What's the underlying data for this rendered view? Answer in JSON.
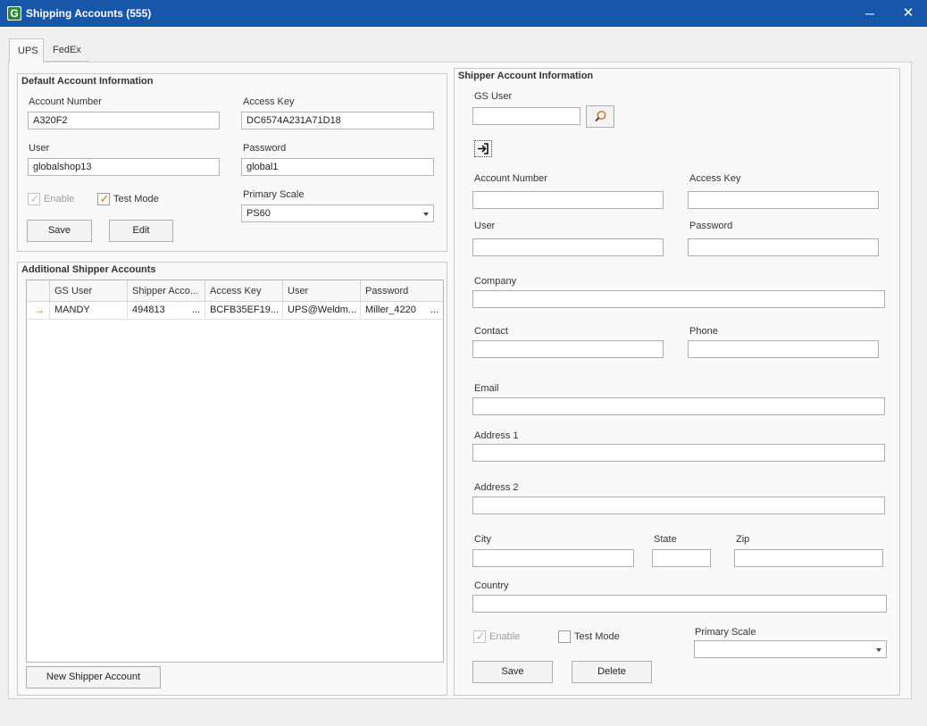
{
  "window": {
    "title": "Shipping Accounts (555)",
    "logo_letter": "G",
    "minimize_glyph": "─",
    "close_glyph": "✕"
  },
  "tabs": [
    {
      "label": "UPS",
      "selected": true
    },
    {
      "label": "FedEx",
      "selected": false
    }
  ],
  "default_account": {
    "title": "Default Account Information",
    "account_number_label": "Account Number",
    "account_number": "A320F2",
    "access_key_label": "Access Key",
    "access_key": "DC6574A231A71D18",
    "user_label": "User",
    "user": "globalshop13",
    "password_label": "Password",
    "password": "global1",
    "enable_label": "Enable",
    "enable_checked": true,
    "test_mode_label": "Test Mode",
    "test_mode_checked": true,
    "primary_scale_label": "Primary Scale",
    "primary_scale": "PS60",
    "save_label": "Save",
    "edit_label": "Edit"
  },
  "additional_accounts": {
    "title": "Additional Shipper Accounts",
    "columns": [
      "GS User",
      "Shipper Acco...",
      "Access Key",
      "User",
      "Password"
    ],
    "rows": [
      {
        "gs_user": "MANDY",
        "shipper_account": "494813",
        "shipper_more": "...",
        "access_key": "BCFB35EF19...",
        "user": "UPS@Weldm...",
        "password": "Miller_4220",
        "password_more": "..."
      }
    ],
    "current_row_glyph": "→",
    "new_button_label": "New Shipper Account"
  },
  "shipper_account": {
    "title": "Shipper Account Information",
    "gs_user_label": "GS User",
    "gs_user": "",
    "search_icon": "magnifier-icon",
    "import_icon": "import-arrow-icon",
    "account_number_label": "Account Number",
    "account_number": "",
    "access_key_label": "Access Key",
    "access_key": "",
    "user_label": "User",
    "user": "",
    "password_label": "Password",
    "password": "",
    "company_label": "Company",
    "company": "",
    "contact_label": "Contact",
    "contact": "",
    "phone_label": "Phone",
    "phone": "",
    "email_label": "Email",
    "email": "",
    "address1_label": "Address 1",
    "address1": "",
    "address2_label": "Address 2",
    "address2": "",
    "city_label": "City",
    "city": "",
    "state_label": "State",
    "state": "",
    "zip_label": "Zip",
    "zip": "",
    "country_label": "Country",
    "country": "",
    "enable_label": "Enable",
    "enable_checked": true,
    "test_mode_label": "Test Mode",
    "test_mode_checked": false,
    "primary_scale_label": "Primary Scale",
    "primary_scale": "",
    "save_label": "Save",
    "delete_label": "Delete"
  },
  "colors": {
    "titlebar": "#1756a9",
    "accent_check": "#e06c1b",
    "logo_green": "#2e8b3a"
  }
}
